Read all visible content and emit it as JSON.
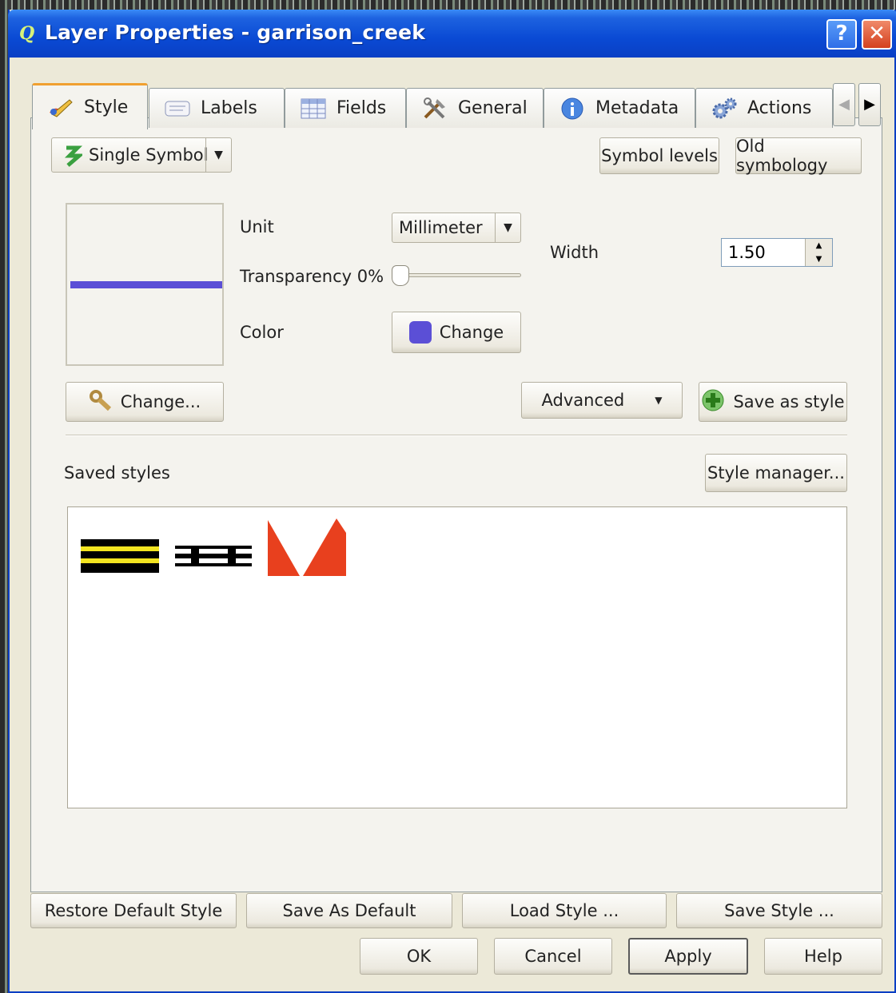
{
  "window": {
    "title": "Layer Properties - garrison_creek",
    "help_glyph": "?",
    "close_glyph": "✕"
  },
  "tabs": [
    {
      "label": "Style",
      "icon": "paintbrush-icon",
      "active": true
    },
    {
      "label": "Labels",
      "icon": "labels-icon"
    },
    {
      "label": "Fields",
      "icon": "table-icon"
    },
    {
      "label": "General",
      "icon": "tools-icon"
    },
    {
      "label": "Metadata",
      "icon": "info-icon"
    },
    {
      "label": "Actions",
      "icon": "gears-icon"
    }
  ],
  "tab_scroll": {
    "left": "◀",
    "right": "▶"
  },
  "renderer": {
    "type": "Single Symbol",
    "symbol_levels": "Symbol levels",
    "old_symbology": "Old symbology"
  },
  "symbol": {
    "unit_label": "Unit",
    "unit_value": "Millimeter",
    "transparency_label": "Transparency 0%",
    "transparency_value": 0,
    "color_label": "Color",
    "color_button": "Change",
    "color_hex": "#5b4fd6",
    "width_label": "Width",
    "width_value": "1.50",
    "change_button": "Change...",
    "advanced_button": "Advanced",
    "save_as_style": "Save as style"
  },
  "saved_styles": {
    "label": "Saved styles",
    "manager_button": "Style manager..."
  },
  "bottom_buttons": {
    "restore": "Restore Default Style",
    "save_default": "Save As Default",
    "load": "Load Style ...",
    "save": "Save Style ...",
    "ok": "OK",
    "cancel": "Cancel",
    "apply": "Apply",
    "help": "Help"
  },
  "colors": {
    "title_bar": "#0a4ad4",
    "dialog_bg": "#ece9d8",
    "accent_red": "#e8401e",
    "tab_highlight": "#f0a030"
  }
}
